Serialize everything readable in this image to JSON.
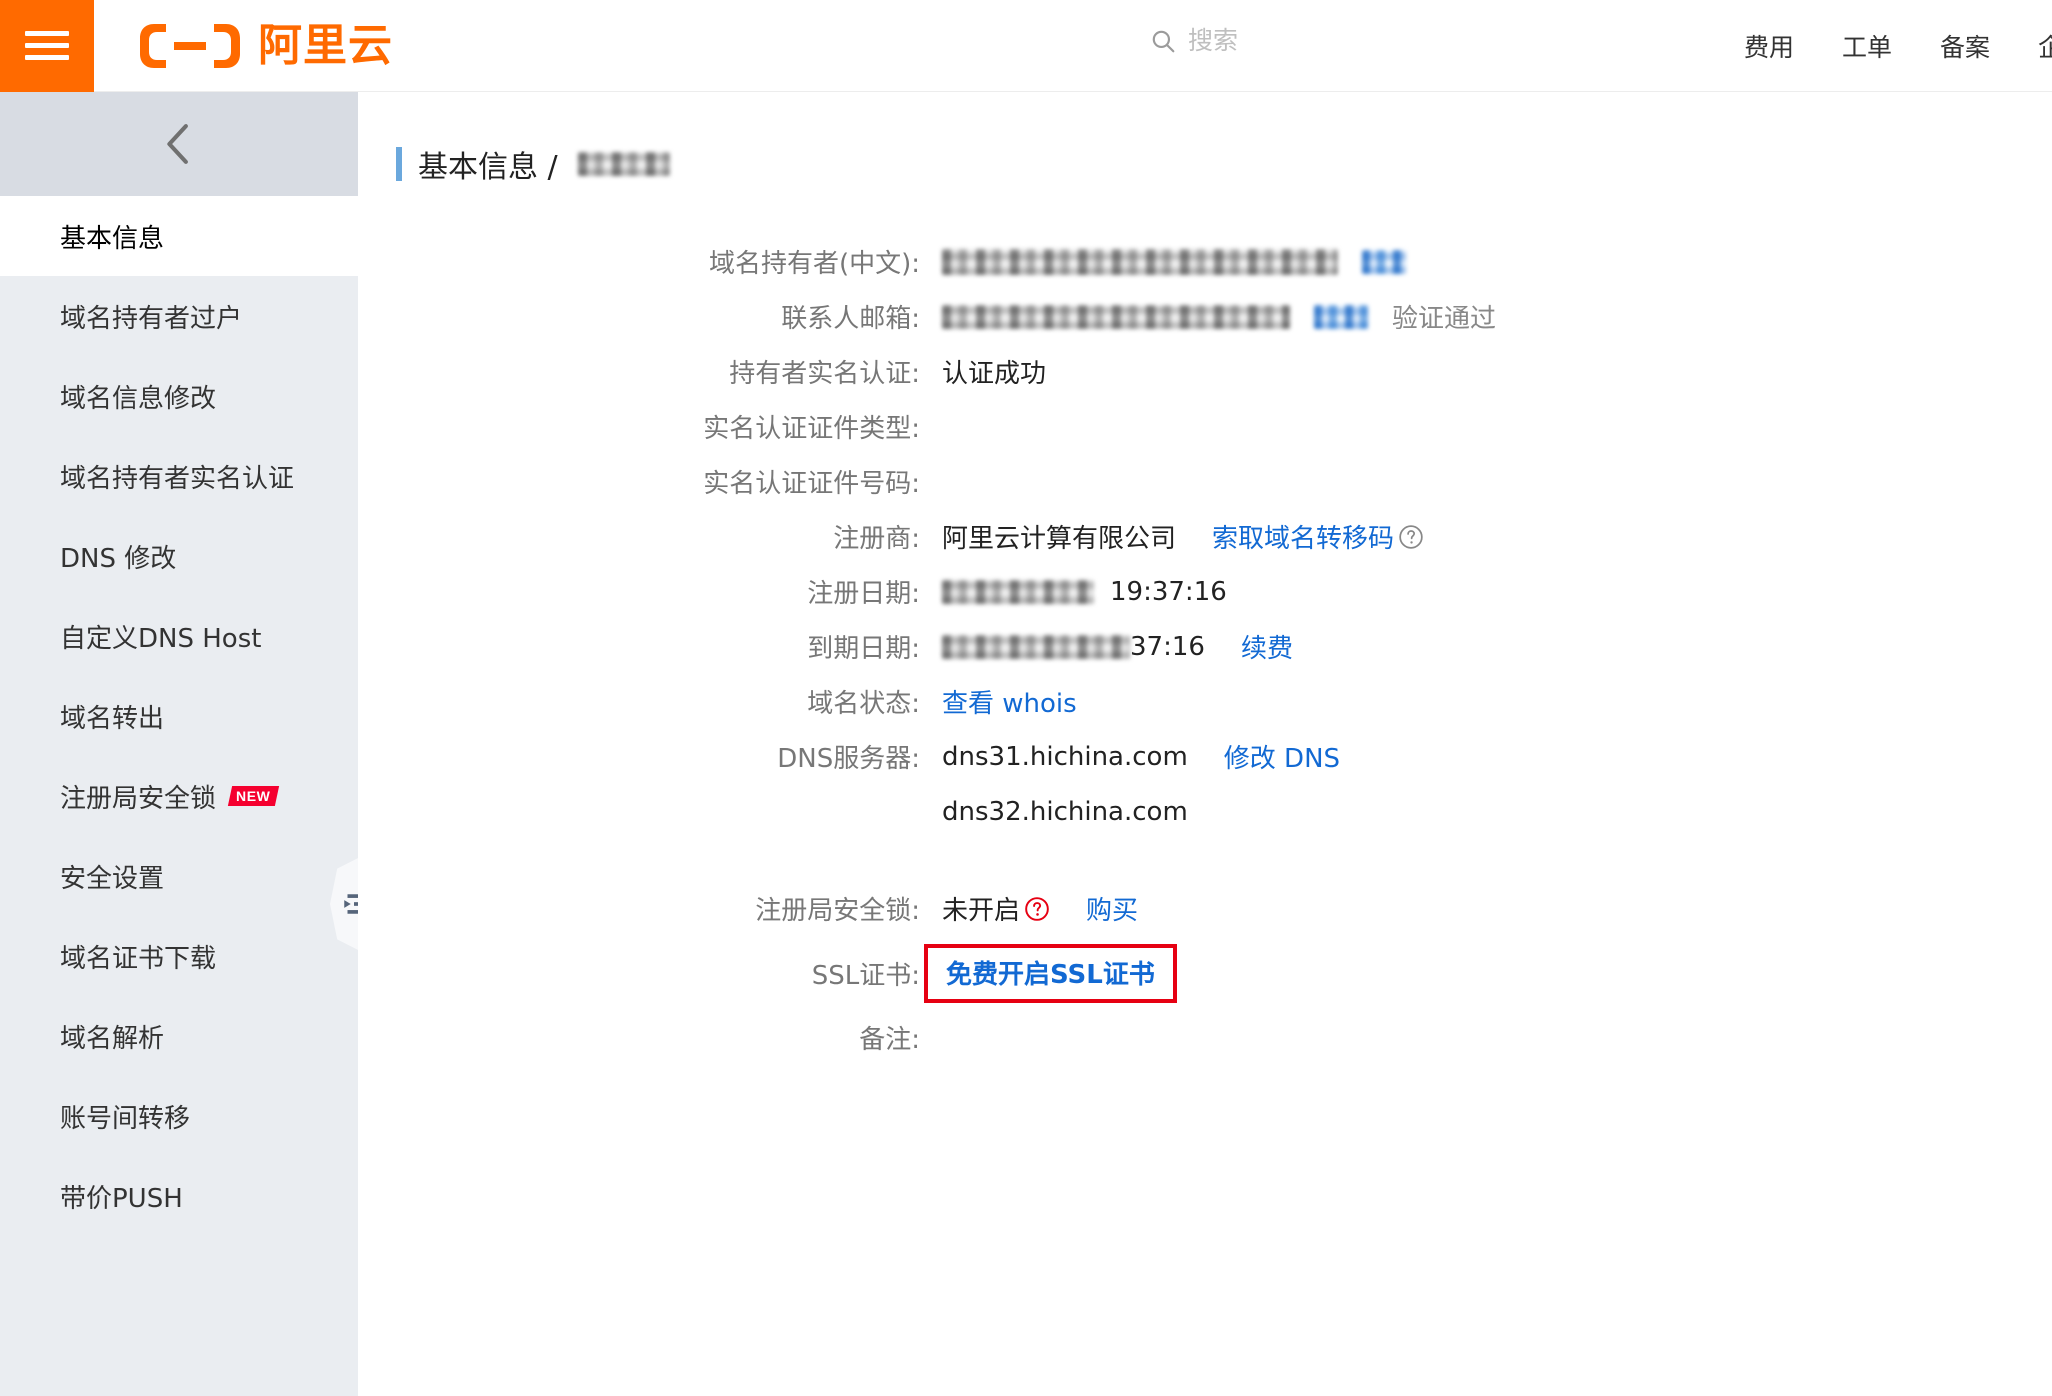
{
  "header": {
    "menu_icon": "hamburger-icon",
    "logo_text": "阿里云",
    "search": {
      "placeholder": "搜索",
      "value": "",
      "icon": "search-icon"
    },
    "nav": [
      {
        "label": "费用"
      },
      {
        "label": "工单"
      },
      {
        "label": "备案"
      },
      {
        "label": "企"
      }
    ]
  },
  "sidebar": {
    "collapse_icon": "chevron-left-icon",
    "handle_icon": "menu-collapse-icon",
    "items": [
      {
        "label": "基本信息",
        "active": true
      },
      {
        "label": "域名持有者过户",
        "active": false
      },
      {
        "label": "域名信息修改",
        "active": false
      },
      {
        "label": "域名持有者实名认证",
        "active": false
      },
      {
        "label": "DNS 修改",
        "active": false
      },
      {
        "label": "自定义DNS Host",
        "active": false
      },
      {
        "label": "域名转出",
        "active": false
      },
      {
        "label": "注册局安全锁",
        "active": false,
        "badge": "NEW"
      },
      {
        "label": "安全设置",
        "active": false
      },
      {
        "label": "域名证书下载",
        "active": false
      },
      {
        "label": "域名解析",
        "active": false
      },
      {
        "label": "账号间转移",
        "active": false
      },
      {
        "label": "带价PUSH",
        "active": false
      }
    ]
  },
  "breadcrumb": {
    "title": "基本信息 /",
    "domain_redacted": true
  },
  "details": {
    "rows": [
      {
        "label": "域名持有者(中文):",
        "value": "",
        "redacted": true,
        "redacted_link": true
      },
      {
        "label": "联系人邮箱:",
        "value": "",
        "redacted": true,
        "redacted_link": true,
        "status": "验证通过"
      },
      {
        "label": "持有者实名认证:",
        "value": "认证成功"
      },
      {
        "label": "实名认证证件类型:",
        "value": ""
      },
      {
        "label": "实名认证证件号码:",
        "value": ""
      },
      {
        "label": "注册商:",
        "value": "阿里云计算有限公司",
        "link": "索取域名转移码",
        "help_icon": "question-circle-icon"
      },
      {
        "label": "注册日期:",
        "value": "19:37:16",
        "redacted_prefix": true
      },
      {
        "label": "到期日期:",
        "value": "37:16",
        "redacted_prefix": true,
        "link": "续费"
      },
      {
        "label": "域名状态:",
        "link": "查看 whois"
      },
      {
        "label": "DNS服务器:",
        "value": "dns31.hichina.com",
        "link": "修改 DNS"
      },
      {
        "label": "",
        "value": "dns32.hichina.com"
      },
      {
        "label": "注册局安全锁:",
        "value": "未开启",
        "help_icon": "question-circle-red-icon",
        "link": "购买"
      },
      {
        "label": "SSL证书:",
        "link": "免费开启SSL证书",
        "highlighted": true
      },
      {
        "label": "备注:",
        "value": ""
      }
    ]
  },
  "colors": {
    "brand_orange": "#ff6a00",
    "link_blue": "#1269d3",
    "highlight_red": "#e60012",
    "badge_red": "#f5002f",
    "sidebar_bg": "#eaedf1",
    "sidebar_top_bg": "#d8dce3"
  }
}
